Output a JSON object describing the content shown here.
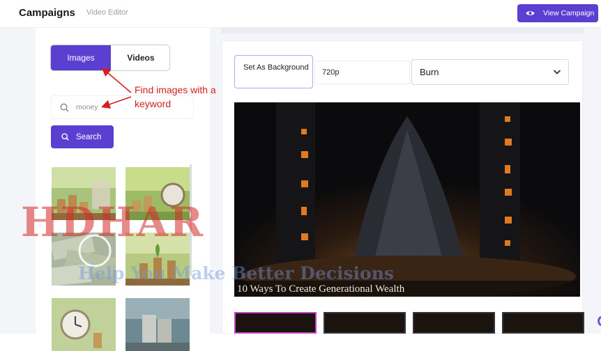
{
  "header": {
    "title": "Campaigns",
    "subtitle": "Video Editor",
    "view_campaign_label": "View Campaign",
    "view_campaign_icon": "eye-icon"
  },
  "media_tabs": [
    {
      "label": "Images",
      "active": true
    },
    {
      "label": "Videos",
      "active": false
    }
  ],
  "search": {
    "value": "money",
    "button_label": "Search",
    "icon": "search-icon"
  },
  "annotation": {
    "text": "Find images with a keyword"
  },
  "image_results": [
    {
      "icon": "coin-jar-plant-image"
    },
    {
      "icon": "alarm-clock-coins-image"
    },
    {
      "icon": "dollar-bills-image"
    },
    {
      "icon": "coin-stacks-plants-image"
    },
    {
      "icon": "clock-coins-image"
    },
    {
      "icon": "coin-stacks-image"
    }
  ],
  "editor": {
    "set_background_label": "Set As Background",
    "resolution": "720p",
    "effect_selected": "Burn",
    "preview_caption": "10 Ways To Create Generational Wealth"
  },
  "watermark": {
    "big": "HDHAR",
    "small": "Help You Make Better Decisions"
  },
  "colors": {
    "accent": "#5b3fd0",
    "annotation": "#d21f1f",
    "selected_frame": "#c444c9"
  }
}
